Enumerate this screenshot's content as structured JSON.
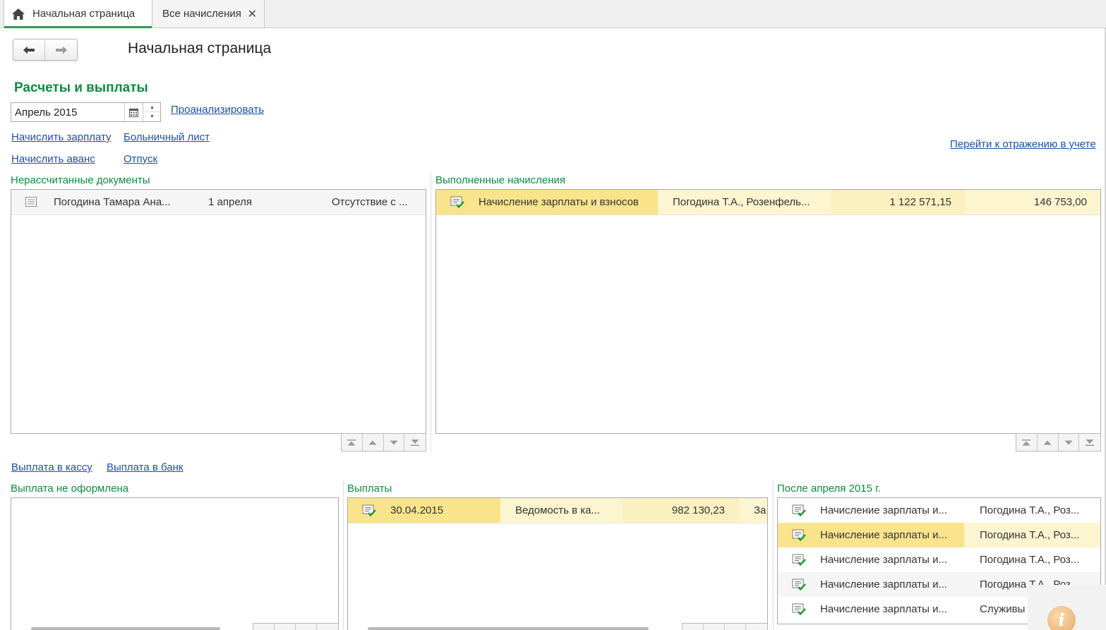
{
  "tabs": [
    {
      "label": "Начальная страница",
      "icon": "home-icon",
      "active": true
    },
    {
      "label": "Все начисления",
      "icon": "close-icon",
      "active": false
    }
  ],
  "header": {
    "title": "Начальная страница"
  },
  "section": {
    "title": "Расчеты и выплаты",
    "period_value": "Апрель 2015",
    "analyze_link": "Проанализировать"
  },
  "actions": {
    "accrue_salary": "Начислить зарплату",
    "sick_leave": "Больничный лист",
    "accrue_advance": "Начислить аванс",
    "vacation": "Отпуск",
    "goto_accounting": "Перейти к отражению в учете",
    "pay_cash": "Выплата в кассу",
    "pay_bank": "Выплата в банк"
  },
  "uncalculated": {
    "label": "Нерассчитанные документы",
    "rows": [
      {
        "employee": "Погодина Тамара Ана...",
        "date": "1 апреля",
        "kind": "Отсутствие с ..."
      }
    ]
  },
  "completed": {
    "label": "Выполненные начисления",
    "rows": [
      {
        "doc": "Начисление зарплаты и взносов",
        "employees": "Погодина Т.А., Розенфель...",
        "amount": "1 122 571,15",
        "amount2": "146 753,00"
      }
    ]
  },
  "unpaid": {
    "label": "Выплата не оформлена"
  },
  "payments": {
    "label": "Выплаты",
    "rows": [
      {
        "date": "30.04.2015",
        "doc": "Ведомость в ка...",
        "amount": "982 130,23",
        "extra": "За"
      }
    ]
  },
  "after": {
    "label": "После апреля 2015 г.",
    "rows": [
      {
        "doc": "Начисление зарплаты и...",
        "who": "Погодина Т.А., Роз..."
      },
      {
        "doc": "Начисление зарплаты и...",
        "who": "Погодина Т.А., Роз..."
      },
      {
        "doc": "Начисление зарплаты и...",
        "who": "Погодина Т.А., Роз..."
      },
      {
        "doc": "Начисление зарплаты и...",
        "who": "Погодина Т.А., Роз..."
      },
      {
        "doc": "Начисление зарплаты и...",
        "who": "Служивы"
      }
    ]
  },
  "colors": {
    "accent_green": "#0e8a3c",
    "link_blue": "#1e4fa0",
    "selection": "#f9e48b",
    "row_highlight": "#fcf5d0"
  }
}
